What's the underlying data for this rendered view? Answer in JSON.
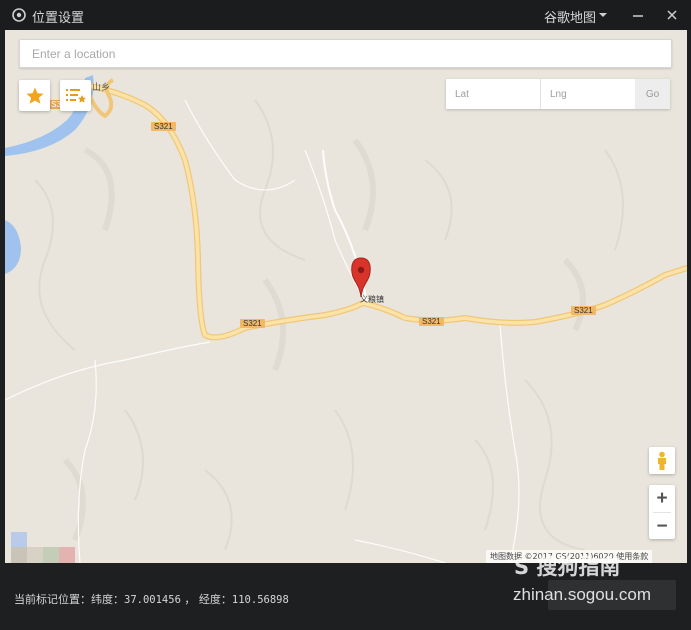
{
  "window": {
    "title": "位置设置",
    "map_provider": "谷歌地图",
    "minimize_glyph": "—",
    "close_glyph": "✕"
  },
  "map": {
    "search_placeholder": "Enter a location",
    "lat_placeholder": "Lat",
    "lng_placeholder": "Lng",
    "go_label": "Go",
    "zoom_in_label": "+",
    "zoom_out_label": "−",
    "attribution": "地图数据 ©2017 GS(2011)6020  使用条款",
    "labels": {
      "village_top": "山乡",
      "town": "义粮镇",
      "road_s321_a": "S321",
      "road_s321_b": "S321",
      "road_s321_c": "S321",
      "road_s321_d": "S321",
      "road_s3_top": "S3"
    },
    "icons": {
      "favorites": "star-icon",
      "list": "list-star-icon",
      "marker": "map-pin-icon",
      "street_view": "pegman-icon"
    },
    "colors": {
      "land": "#e9e5dc",
      "road": "#f6d58e",
      "river": "#9fc3ee",
      "marker": "#d8342b",
      "favorite_star": "#f3a41c"
    }
  },
  "status": {
    "label": "当前标记位置：",
    "lat_label": "纬度：",
    "lat_value": "37.001456",
    "separator": "，",
    "lng_label": "经度：",
    "lng_value": "110.56898"
  },
  "watermark": {
    "logo_text": "S 搜狗指南",
    "url": "zhinan.sogou.com"
  }
}
